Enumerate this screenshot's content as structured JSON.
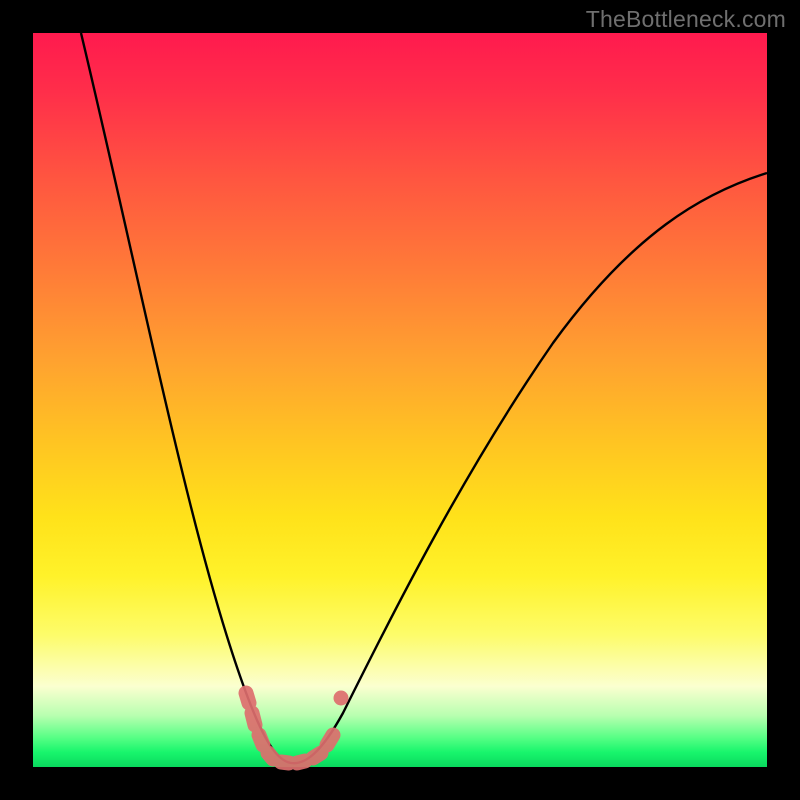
{
  "watermark": "TheBottleneck.com",
  "colors": {
    "frame": "#000000",
    "curve": "#000000",
    "dots": "#e07070",
    "gradient_top": "#ff1a4e",
    "gradient_bottom": "#0ad85e"
  },
  "chart_data": {
    "type": "line",
    "title": "",
    "xlabel": "",
    "ylabel": "",
    "xlim": [
      0,
      100
    ],
    "ylim": [
      0,
      100
    ],
    "note": "No axes, ticks or numeric labels are rendered; this is a bottleneck V-curve. Values estimated from geometry as percentage of plot width/height (origin bottom-left).",
    "series": [
      {
        "name": "bottleneck-curve",
        "x": [
          0,
          5,
          10,
          15,
          20,
          23,
          26,
          29,
          31,
          33,
          35,
          38,
          41,
          45,
          50,
          55,
          60,
          65,
          70,
          75,
          80,
          85,
          90,
          95,
          100
        ],
        "y": [
          100,
          84,
          68,
          52,
          36,
          26,
          17,
          9,
          4,
          1,
          0,
          0,
          1,
          4,
          10,
          18,
          27,
          36,
          45,
          53,
          61,
          68,
          74,
          78,
          81
        ]
      }
    ],
    "highlight_points": {
      "name": "pink-dots-near-minimum",
      "x": [
        28.5,
        29.5,
        30.5,
        31.5,
        33,
        34.5,
        36,
        37.5,
        39,
        40.5,
        41.5
      ],
      "y": [
        9,
        6,
        3.5,
        1.8,
        0.5,
        0.3,
        0.4,
        0.8,
        1.6,
        3.2,
        8.5
      ]
    }
  }
}
